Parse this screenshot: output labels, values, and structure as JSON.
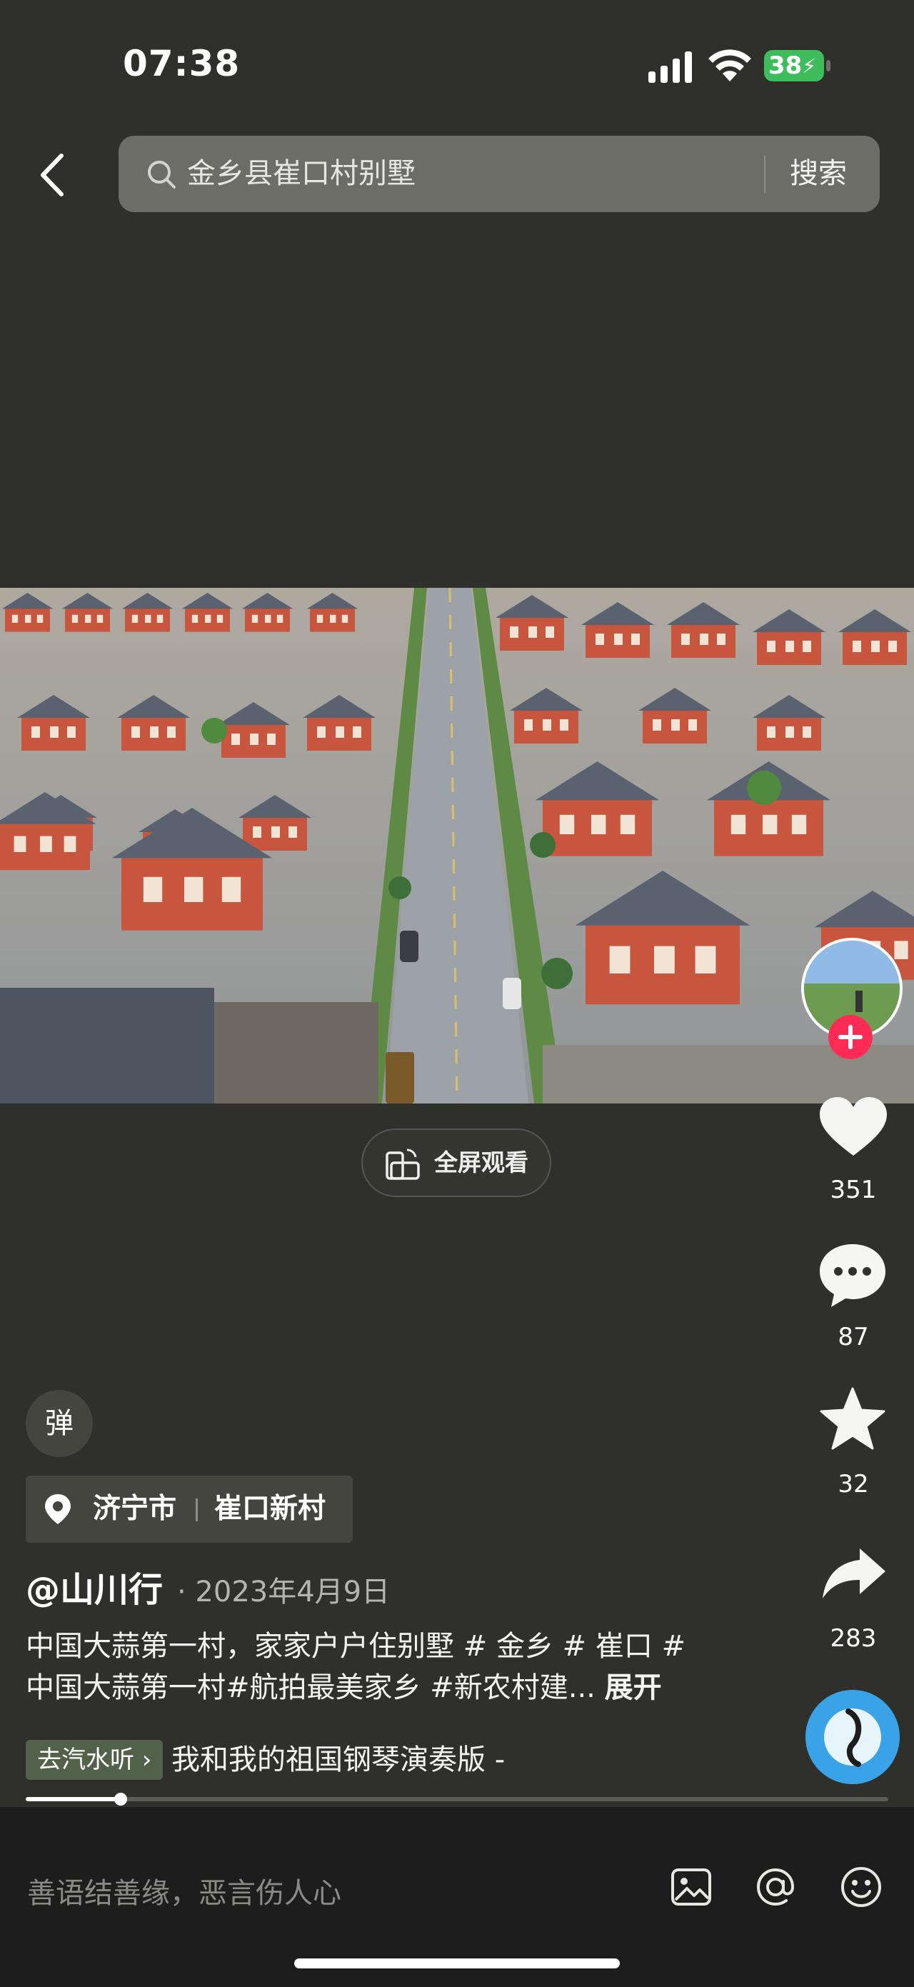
{
  "status": {
    "time": "07:38",
    "battery": "38"
  },
  "search": {
    "query": "金乡县崔口村别墅",
    "button": "搜索"
  },
  "video": {
    "fullscreen_label": "全屏观看"
  },
  "actions": {
    "likes": "351",
    "comments": "87",
    "favorites": "32",
    "shares": "283"
  },
  "danmu": "弹",
  "location": {
    "city": "济宁市",
    "place": "崔口新村"
  },
  "post": {
    "author": "@山川行",
    "date": "· 2023年4月9日",
    "caption_line1": "中国大蒜第一村，家家户户住别墅 # 金乡 # 崔口 #",
    "caption_line2": "中国大蒜第一村#航拍最美家乡 #新农村建... ",
    "expand": "展开"
  },
  "music": {
    "tag": "去汽水听 ›",
    "title": "我和我的祖国钢琴演奏版 -"
  },
  "progress": {
    "fraction": 0.11
  },
  "comment": {
    "placeholder": "善语结善缘，恶言伤人心"
  },
  "colors": {
    "background": "#2f302b",
    "follow": "#fe2c55",
    "battery": "#3fbd5d"
  },
  "icons": [
    "back-icon",
    "search-icon",
    "heart-icon",
    "comment-icon",
    "star-icon",
    "share-icon",
    "location-pin-icon",
    "image-icon",
    "at-icon",
    "emoji-icon"
  ]
}
